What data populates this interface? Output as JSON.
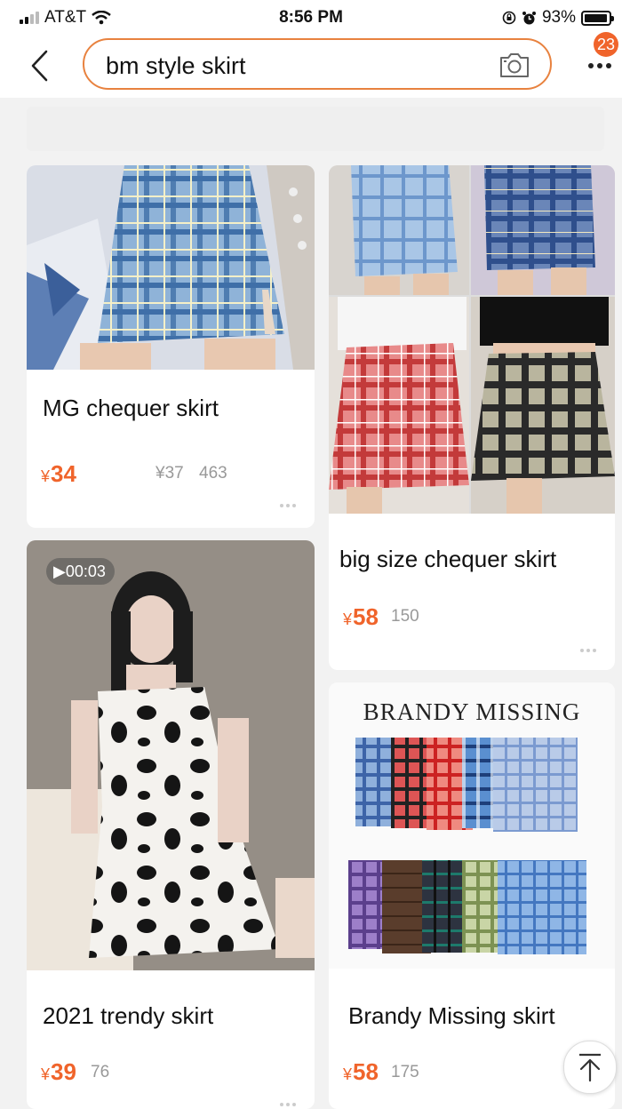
{
  "status_bar": {
    "carrier": "AT&T",
    "time": "8:56 PM",
    "battery": "93%",
    "icons": [
      "signal-icon",
      "wifi-icon",
      "orientation-lock-icon",
      "alarm-icon",
      "battery-icon"
    ]
  },
  "header": {
    "search_value": "bm style skirt",
    "notification_count": "23",
    "icons": [
      "back-icon",
      "camera-icon",
      "more-icon"
    ]
  },
  "products": [
    {
      "title": "MG chequer skirt",
      "currency": "¥",
      "price": "34",
      "original_price": "¥37",
      "sales": "463"
    },
    {
      "title": "big size chequer skirt",
      "currency": "¥",
      "price": "58",
      "sales": "150"
    },
    {
      "title": "2021 trendy skirt",
      "currency": "¥",
      "price": "39",
      "sales": "76",
      "video_duration": "00:03"
    },
    {
      "title": "Brandy Missing skirt",
      "currency": "¥",
      "price": "58",
      "sales": "175",
      "banner": "BRANDY MISSING"
    }
  ],
  "colors": {
    "accent": "#f0642b",
    "search_border": "#e8823f",
    "background": "#f2f2f2"
  }
}
